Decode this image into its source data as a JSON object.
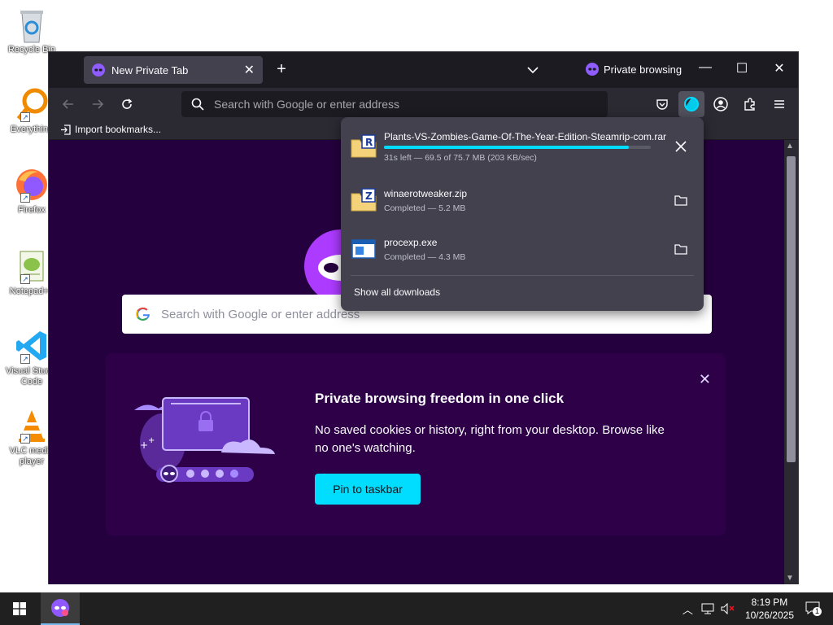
{
  "desktop": {
    "icons": [
      {
        "label": "Recycle Bin",
        "icon": "recycle-bin-icon"
      },
      {
        "label": "Everything",
        "icon": "everything-search-icon"
      },
      {
        "label": "Firefox",
        "icon": "firefox-icon"
      },
      {
        "label": "Notepad++",
        "icon": "notepad-plus-plus-icon"
      },
      {
        "label": "Visual Studio Code",
        "icon": "vscode-icon"
      },
      {
        "label": "VLC media player",
        "icon": "vlc-icon"
      }
    ]
  },
  "browser": {
    "tab": {
      "title": "New Private Tab"
    },
    "private_label": "Private browsing",
    "urlbar": {
      "placeholder": "Search with Google or enter address"
    },
    "bookmarks": {
      "import_label": "Import bookmarks..."
    },
    "page": {
      "search_placeholder": "Search with Google or enter address",
      "promo": {
        "title": "Private browsing freedom in one click",
        "body": "No saved cookies or history, right from your desktop. Browse like no one's watching.",
        "button": "Pin to taskbar"
      }
    },
    "downloads": {
      "items": [
        {
          "name": "Plants-VS-Zombies-Game-Of-The-Year-Edition-Steamrip-com.rar",
          "status": "31s left — 69.5 of 75.7 MB (203 KB/sec)",
          "progress": 0.918,
          "action": "cancel"
        },
        {
          "name": "winaerotweaker.zip",
          "status": "Completed — 5.2 MB",
          "action": "show-in-folder"
        },
        {
          "name": "procexp.exe",
          "status": "Completed — 4.3 MB",
          "action": "show-in-folder"
        }
      ],
      "show_all": "Show all downloads"
    },
    "colors": {
      "accent": "#00ddff",
      "private_purple": "#25003e",
      "mask_purple": "#ad3bff"
    }
  },
  "taskbar": {
    "time": "8:19 PM",
    "date": "10/26/2025",
    "notification_count": "1"
  }
}
